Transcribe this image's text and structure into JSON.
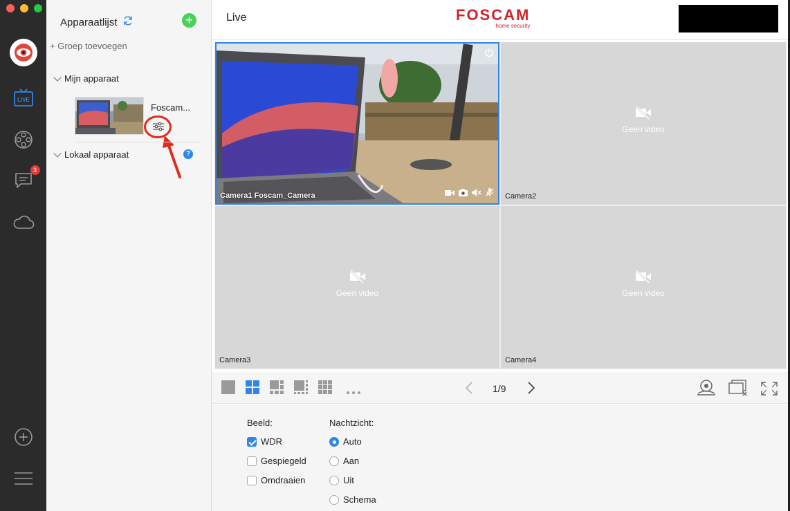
{
  "sidebar": {
    "notification_count": "3"
  },
  "panel": {
    "title": "Apparaatlijst",
    "add_group": "+ Groep toevoegen",
    "my_devices": "Mijn apparaat",
    "device_name": "Foscam...",
    "local_devices": "Lokaal apparaat",
    "help": "?"
  },
  "header": {
    "title": "Live",
    "brand": "FOSCAM",
    "brand_sub": "home security"
  },
  "cameras": [
    {
      "label": "Camera1 Foscam_Camera"
    },
    {
      "label": "Camera2",
      "status": "Geen video"
    },
    {
      "label": "Camera3",
      "status": "Geen video"
    },
    {
      "label": "Camera4",
      "status": "Geen video"
    }
  ],
  "toolbar": {
    "page": "1/9"
  },
  "image_settings": {
    "title": "Beeld:",
    "options": [
      {
        "label": "WDR",
        "checked": true
      },
      {
        "label": "Gespiegeld",
        "checked": false
      },
      {
        "label": "Omdraaien",
        "checked": false
      }
    ]
  },
  "night_vision": {
    "title": "Nachtzicht:",
    "options": [
      {
        "label": "Auto",
        "selected": true
      },
      {
        "label": "Aan",
        "selected": false
      },
      {
        "label": "Uit",
        "selected": false
      },
      {
        "label": "Schema",
        "selected": false
      }
    ]
  },
  "colors": {
    "accent": "#2f86e8",
    "brand": "#d2232a",
    "annotation": "#e02b1c"
  }
}
